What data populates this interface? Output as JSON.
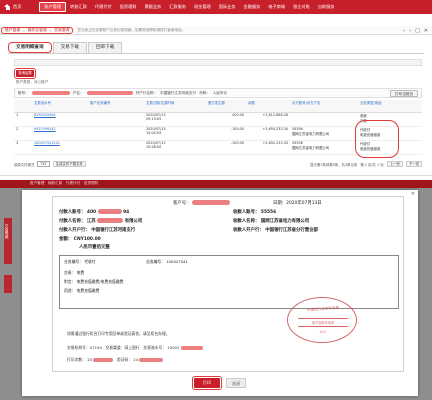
{
  "nav": {
    "home": "首页",
    "menu": [
      "账户管理",
      "转账汇款",
      "代理代付",
      "投资理财",
      "票据业务",
      "汇款服务",
      "现金管理",
      "国际业务",
      "金融服务",
      "电子商城",
      "银企对账",
      "自助服务"
    ],
    "active_index": 0
  },
  "breadcrumb": {
    "items": [
      "账户管理",
      "操作员管理",
      "交易查询"
    ],
    "rest": "您当前正在查看账户交易记录明细，如需其他帮助请拨打客服电话。"
  },
  "window_controls": [
    "‹",
    "›",
    "□",
    "✕"
  ],
  "tabs": [
    "交易明细查询",
    "交易下载",
    "回单下载"
  ],
  "query_badge": "查询结果",
  "account_type": "账户类型：对公账户",
  "filter": {
    "account_label": "账号：",
    "name_label": "户名：",
    "bank_label": "开户行名称：",
    "bank_value": "中国银行江苏河南支行",
    "currency_label": "币种：",
    "currency_value": "人民币元",
    "print_button": "打印当前页"
  },
  "table": {
    "headers": [
      "交易流水号",
      "客户业务编号",
      "交易日期/交易时间",
      "借方发生额",
      "余额",
      "对方账号/对方户名",
      "业务类型/用途"
    ],
    "rows": [
      {
        "index": "1",
        "serial": "8195245904",
        "date": "2020/07/13",
        "time": "09:13:05",
        "amount": "400.00",
        "balance": "+2,612,868.28",
        "acct": "",
        "name": "",
        "type": "收款",
        "use": "汇款"
      },
      {
        "index": "2",
        "serial": "9937599242",
        "date": "2020/07/13",
        "time": "10:04:55",
        "amount": "-100.00",
        "balance": "+2,650,233.30",
        "acct": "55556",
        "name": "国网江苏省电力有限公司",
        "type": "代收付",
        "use": "电费充值缴费"
      },
      {
        "index": "3",
        "serial": "100027541241",
        "date": "2020/07/13",
        "time": "10:28:50",
        "amount": "-100.00",
        "balance": "+2,650,233.30",
        "acct": "55556",
        "name": "国网江苏省电力有限公司",
        "type": "代收付",
        "use": "电费充值缴费"
      }
    ]
  },
  "footer": {
    "format_label": "选择文件格式",
    "format_value": "TXT",
    "export_button": "生成文件下载文件",
    "total": "显示第1条到第3条，共3条记录",
    "page": "第 1 页/共 1 页",
    "prev": "上一页",
    "next": "下一页"
  },
  "bottom_nav": "账户管理　转账汇款　代理代付　投资理财",
  "side_tab": "交易明细",
  "receipt": {
    "customer_no_label": "客户号：",
    "date": "日期：2020年07月13日",
    "payer_acct_label": "付款人账号：",
    "payer_acct": "400",
    "payer_acct_suffix": "94",
    "payee_acct_label": "收款人账号：",
    "payee_acct": "55556",
    "payer_name_label": "付款人名称：",
    "payer_name": "江苏",
    "payer_name_suffix": "有限公司",
    "payee_name_label": "收款人名称：",
    "payee_name": "国网江苏省电力有限公司",
    "payer_bank_label": "付款人开户行：",
    "payer_bank": "中国银行江苏河南支行",
    "payee_bank_label": "收款人开户行：",
    "payee_bank": "中国银行江苏省分行营业部",
    "amount_label": "金额：",
    "amount": "CNY100.00",
    "amount_cn": "人民币壹佰元整",
    "biz_no_label": "业务编号：",
    "biz_no_value": "代收付",
    "biz_id_label": "业务编号：",
    "biz_id_value": "100027541",
    "tx_label": "交易：",
    "tx_value": "电费",
    "use_label": "附言：",
    "use_value": "电费充值缴费/电费充值缴费",
    "purpose_label": "用途：",
    "purpose_value": "电费充值缴费",
    "note": "如需通过银行柜台打印专用回单或验证真伪，请至柜台办理。",
    "voucher_label": "交易机构号：07194",
    "channel": "交易渠道：网上银行",
    "serial_label": "交易流水号：",
    "serial_value": "10002",
    "print_no_label": "打印次数：",
    "print_no_value": "20",
    "auth_label": "验证码：",
    "auth_value": "24"
  },
  "stamp": {
    "top": "中国银行业务专用章",
    "middle": "电子回单专用章",
    "bottom": "（01）"
  },
  "dialog": {
    "print_button": "打印",
    "close_button": "关闭",
    "close_icon": "✕"
  }
}
